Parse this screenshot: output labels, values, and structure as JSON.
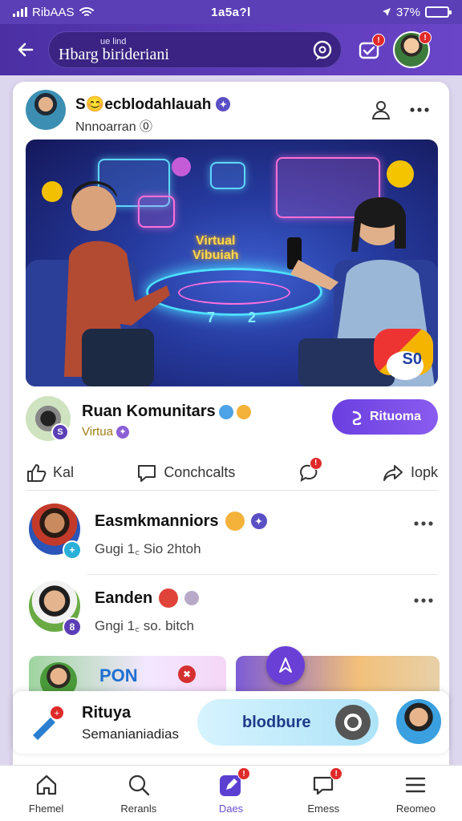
{
  "status_bar": {
    "carrier": "RibAAS",
    "time": "1a5a?l",
    "battery": "37%",
    "battery_level": 0.37
  },
  "header": {
    "title_small": "ue lind",
    "title": "Hbarg birideriani",
    "notification_count": "!",
    "profile_badge": "!"
  },
  "post": {
    "author": "S😊ecblodahlauah",
    "subtitle": "Nnnoarran ⓪",
    "hero_text_1": "Virtual",
    "hero_text_2": "Vibuiah",
    "hero_numbers": "7 2",
    "hero_badge": "S0"
  },
  "community": {
    "name": "Ruan Komunitars",
    "tag": "Virtua",
    "badge": "S",
    "join_label": "Rituoma"
  },
  "actions": {
    "like_label": "Kal",
    "comment_label": "Conchcalts",
    "alert_badge": "!",
    "share_label": "Iopk"
  },
  "comments": [
    {
      "name": "Easmkmanniors",
      "meta": "Gugi 1꜀ Sio 2htoh",
      "badge": "+"
    },
    {
      "name": "Eanden",
      "meta": "Gngi 1꜀ so. bitch",
      "badge": "8"
    }
  ],
  "tiles": {
    "left_label": "PON",
    "left_badge": "✖"
  },
  "mini_player": {
    "title": "Rituya",
    "subtitle": "Semanianiadias",
    "button_label": "blodbure",
    "badge": "+"
  },
  "nav": {
    "items": [
      {
        "label": "Fhemel",
        "icon": "home-icon",
        "badge": ""
      },
      {
        "label": "Reranls",
        "icon": "search-icon",
        "badge": ""
      },
      {
        "label": "Daes",
        "icon": "pen-icon",
        "badge": "!",
        "active": true
      },
      {
        "label": "Emess",
        "icon": "message-icon",
        "badge": "!"
      },
      {
        "label": "Reomeo",
        "icon": "menu-icon",
        "badge": ""
      }
    ]
  },
  "colors": {
    "accent": "#6a45c8",
    "header": "#4b2fa3",
    "join_button": "#7a4fe8",
    "badge_red": "#e02a2a"
  }
}
